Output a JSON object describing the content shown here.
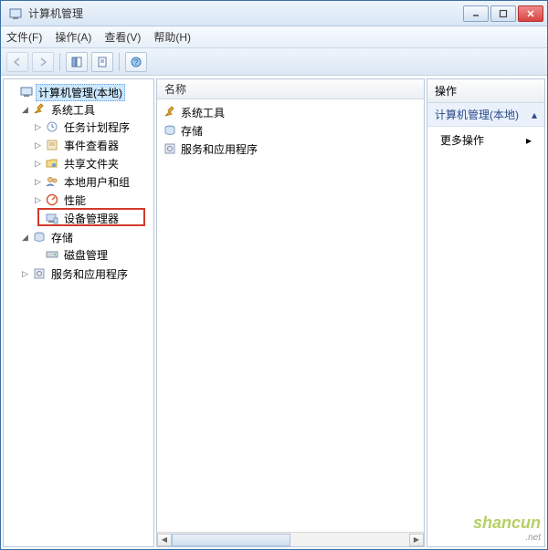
{
  "window": {
    "title": "计算机管理"
  },
  "menu": {
    "file": "文件(F)",
    "action": "操作(A)",
    "view": "查看(V)",
    "help": "帮助(H)"
  },
  "tree": {
    "root": "计算机管理(本地)",
    "systools": "系统工具",
    "tasksched": "任务计划程序",
    "eventvwr": "事件查看器",
    "shared": "共享文件夹",
    "localusers": "本地用户和组",
    "perf": "性能",
    "devmgr": "设备管理器",
    "storage": "存储",
    "diskmgmt": "磁盘管理",
    "services": "服务和应用程序"
  },
  "list": {
    "header": "名称",
    "item_systools": "系统工具",
    "item_storage": "存储",
    "item_services": "服务和应用程序"
  },
  "actions": {
    "header": "操作",
    "section": "计算机管理(本地)",
    "more": "更多操作"
  },
  "watermark": {
    "main": "shancun",
    "sub": ".net"
  }
}
